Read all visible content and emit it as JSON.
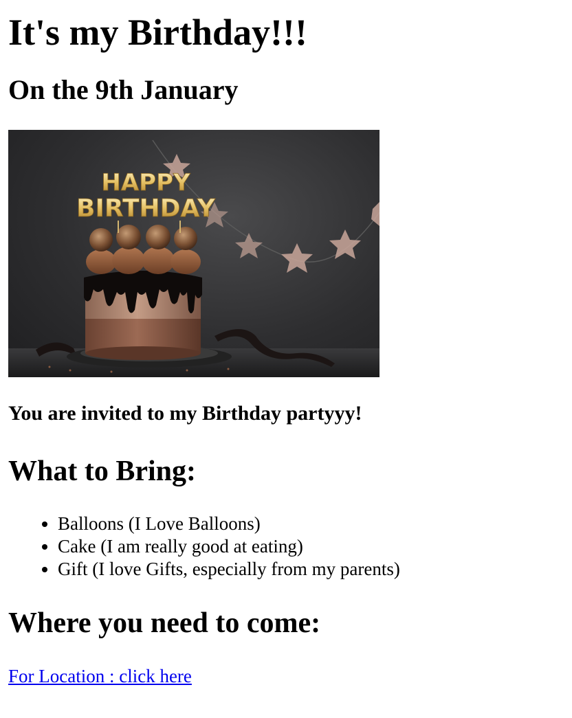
{
  "title": "It's my Birthday!!!",
  "date_heading": "On the 9th January",
  "hero_image": {
    "subject": "chocolate-birthday-cake",
    "topper": [
      "HAPPY",
      "BIRTHDAY"
    ]
  },
  "invite_text": "You are invited to my Birthday partyyy!",
  "bring": {
    "heading": "What to Bring:",
    "items": [
      "Balloons (I Love Balloons)",
      "Cake (I am really good at eating)",
      "Gift (I love Gifts, especially from my parents)"
    ]
  },
  "where": {
    "heading": "Where you need to come:",
    "link_text": "For Location : click here"
  },
  "colors": {
    "link": "#0000ee",
    "text": "#000000",
    "background": "#ffffff"
  }
}
